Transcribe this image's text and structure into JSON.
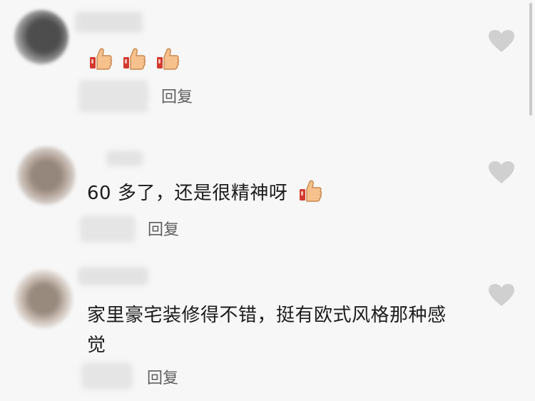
{
  "comments": [
    {
      "text": "",
      "emoji": [
        "thumbs-up-icon",
        "thumbs-up-icon",
        "thumbs-up-icon"
      ],
      "reply_label": "回复"
    },
    {
      "text": "60 多了，还是很精神呀",
      "emoji": [
        "thumbs-up-icon"
      ],
      "reply_label": "回复"
    },
    {
      "text": "家里豪宅装修得不错，挺有欧式风格那种感觉",
      "emoji": [],
      "reply_label": "回复"
    }
  ],
  "colors": {
    "background": "#f7f7f7",
    "text": "#1c1c1c",
    "reply": "#5f5f5f",
    "heart": "#d0d0d0"
  }
}
